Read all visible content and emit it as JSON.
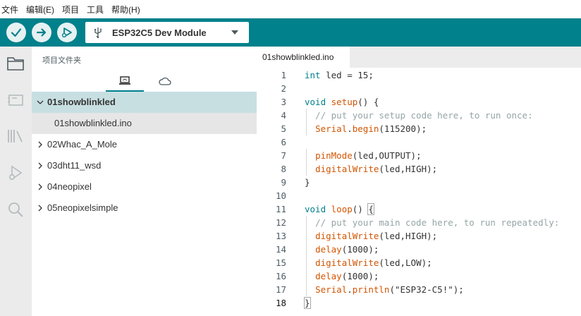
{
  "menu": [
    "文件",
    "编辑(E)",
    "项目",
    "工具",
    "帮助(H)"
  ],
  "toolbar": {
    "verify_icon": "check-icon",
    "upload_icon": "arrow-right-icon",
    "debug_icon": "debug-play-icon",
    "board_name": "ESP32C5 Dev Module",
    "usb_icon": "usb-icon",
    "dropdown_icon": "chevron-down-icon"
  },
  "colors": {
    "accent": "#00818b",
    "activity_bg": "#ebebeb",
    "selected_folder": "#c8dfe2",
    "selected_file": "#e6e6e6"
  },
  "activity_icons": [
    "folder-icon",
    "board-manager-icon",
    "library-icon",
    "debug-icon",
    "search-icon"
  ],
  "sidebar": {
    "title": "项目文件夹",
    "tabs": [
      "local-sketches-icon",
      "cloud-icon"
    ],
    "tree": [
      {
        "label": "01showblinkled",
        "type": "folder",
        "expanded": true
      },
      {
        "label": "01showblinkled.ino",
        "type": "file"
      },
      {
        "label": "02Whac_A_Mole",
        "type": "folder",
        "expanded": false
      },
      {
        "label": "03dht11_wsd",
        "type": "folder",
        "expanded": false
      },
      {
        "label": "04neopixel",
        "type": "folder",
        "expanded": false
      },
      {
        "label": "05neopixelsimple",
        "type": "folder",
        "expanded": false
      }
    ]
  },
  "editor": {
    "tab": "01showblinkled.ino",
    "active_line": 18,
    "lines": [
      "int led = 15;",
      "",
      "void setup() {",
      "  // put your setup code here, to run once:",
      "  Serial.begin(115200);",
      "",
      "  pinMode(led,OUTPUT);",
      "  digitalWrite(led,HIGH);",
      "}",
      "",
      "void loop() {",
      "  // put your main code here, to run repeatedly:",
      "  digitalWrite(led,HIGH);",
      "  delay(1000);",
      "  digitalWrite(led,LOW);",
      "  delay(1000);",
      "  Serial.println(\"ESP32-C5!\");",
      "}"
    ]
  }
}
